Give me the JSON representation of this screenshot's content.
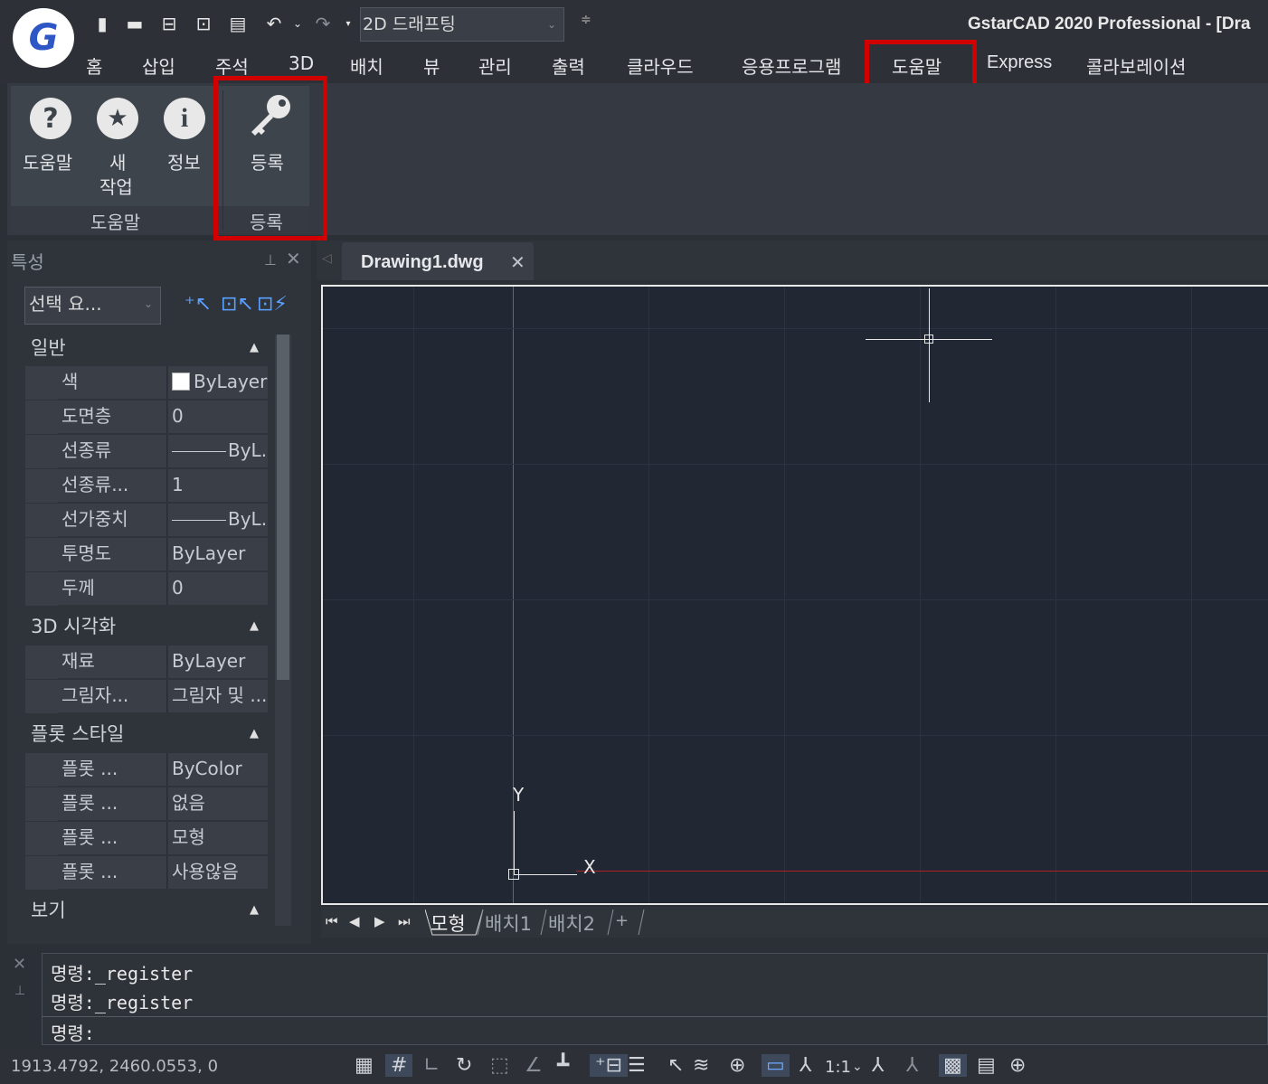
{
  "app": {
    "title": "GstarCAD 2020 Professional - [Dra",
    "logo_letter": "G",
    "workspace": "2D 드래프팅"
  },
  "quick_access": [
    "new-file-icon",
    "open-folder-icon",
    "save-icon",
    "save-as-icon",
    "print-icon",
    "undo-icon",
    "redo-icon"
  ],
  "menu": {
    "items": [
      "홈",
      "삽입",
      "주석",
      "3D",
      "배치",
      "뷰",
      "관리",
      "출력",
      "클라우드",
      "응용프로그램",
      "도움말",
      "Express",
      "콜라보레이션"
    ],
    "active": "도움말"
  },
  "ribbon": {
    "help_panel": {
      "buttons": [
        {
          "label": "도움말",
          "icon": "?"
        },
        {
          "label1": "새",
          "label2": "작업",
          "icon": "★"
        },
        {
          "label": "정보",
          "icon": "i"
        }
      ],
      "title": "도움말"
    },
    "register_panel": {
      "button_label": "등록",
      "title": "등록"
    }
  },
  "properties": {
    "title": "특성",
    "selection": "선택 요...",
    "sections": [
      {
        "title": "일반",
        "rows": [
          {
            "name": "색",
            "value": "ByLayer"
          },
          {
            "name": "도면층",
            "value": "0"
          },
          {
            "name": "선종류",
            "value": "ByL..."
          },
          {
            "name": "선종류...",
            "value": "1"
          },
          {
            "name": "선가중치",
            "value": "ByL..."
          },
          {
            "name": "투명도",
            "value": "ByLayer"
          },
          {
            "name": "두께",
            "value": "0"
          }
        ]
      },
      {
        "title": "3D 시각화",
        "rows": [
          {
            "name": "재료",
            "value": "ByLayer"
          },
          {
            "name": "그림자...",
            "value": "그림자 및 ..."
          }
        ]
      },
      {
        "title": "플롯 스타일",
        "rows": [
          {
            "name": "플롯 ...",
            "value": "ByColor"
          },
          {
            "name": "플롯 ...",
            "value": "없음"
          },
          {
            "name": "플롯 ...",
            "value": "모형"
          },
          {
            "name": "플롯 ...",
            "value": "사용않음"
          }
        ]
      },
      {
        "title": "보기",
        "rows": []
      }
    ]
  },
  "document": {
    "tab": "Drawing1.dwg"
  },
  "ucs": {
    "x_label": "X",
    "y_label": "Y"
  },
  "layout_tabs": [
    "모형",
    "배치1",
    "배치2",
    "+"
  ],
  "command": {
    "lines": [
      "명령:_register",
      "명령:_register"
    ],
    "prompt": "명령:"
  },
  "status": {
    "coords": "1913.4792, 2460.0553, 0",
    "scale": "1:1"
  },
  "colors": {
    "highlight": "#d00000",
    "canvas_bg": "#212833",
    "y_axis": "#2f8a3a",
    "x_axis": "#b02020"
  }
}
